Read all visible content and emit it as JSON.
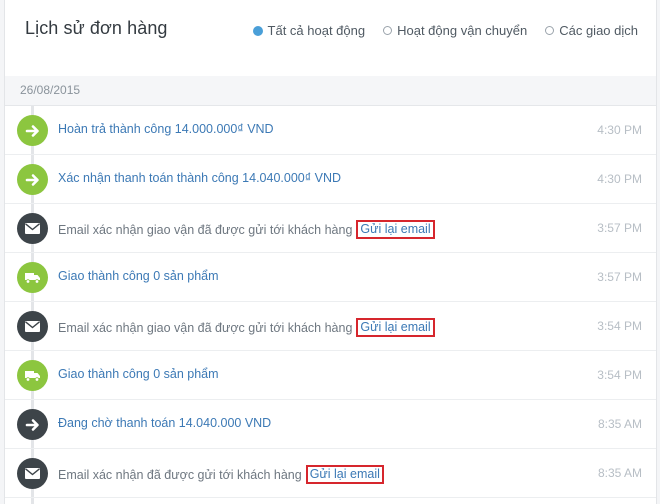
{
  "header": {
    "title": "Lịch sử đơn hàng"
  },
  "filters": [
    {
      "label": "Tất cả hoạt động",
      "selected": true
    },
    {
      "label": "Hoạt động vận chuyển",
      "selected": false
    },
    {
      "label": "Các giao dịch",
      "selected": false
    }
  ],
  "date": "26/08/2015",
  "colors": {
    "green": "#8cc63f",
    "dark": "#3d4449",
    "accent": "#4a9fd8",
    "highlight": "#d6262d"
  },
  "rows": [
    {
      "icon": "arrow-right-icon",
      "icon_color": "green",
      "text": "Hoàn trả thành công 14.000.000₫ VND",
      "time": "4:30 PM"
    },
    {
      "icon": "arrow-right-icon",
      "icon_color": "green",
      "text": "Xác nhận thanh toán thành công 14.040.000₫ VND",
      "time": "4:30 PM"
    },
    {
      "icon": "envelope-icon",
      "icon_color": "dark",
      "text": "Email xác nhận giao vận đã được gửi tới khách hàng",
      "action": "Gửi lại email",
      "time": "3:57 PM"
    },
    {
      "icon": "truck-icon",
      "icon_color": "green",
      "text": "Giao thành công 0 sản phẩm",
      "time": "3:57 PM"
    },
    {
      "icon": "envelope-icon",
      "icon_color": "dark",
      "text": "Email xác nhận giao vận đã được gửi tới khách hàng",
      "action": "Gửi lại email",
      "time": "3:54 PM"
    },
    {
      "icon": "truck-icon",
      "icon_color": "green",
      "text": "Giao thành công 0 sản phẩm",
      "time": "3:54 PM"
    },
    {
      "icon": "arrow-right-icon",
      "icon_color": "dark",
      "text": "Đang chờ thanh toán 14.040.000 VND",
      "time": "8:35 AM"
    },
    {
      "icon": "envelope-icon",
      "icon_color": "dark",
      "text": "Email xác nhận đã được gửi tới khách hàng",
      "action": "Gửi lại email",
      "time": "8:35 AM"
    }
  ]
}
